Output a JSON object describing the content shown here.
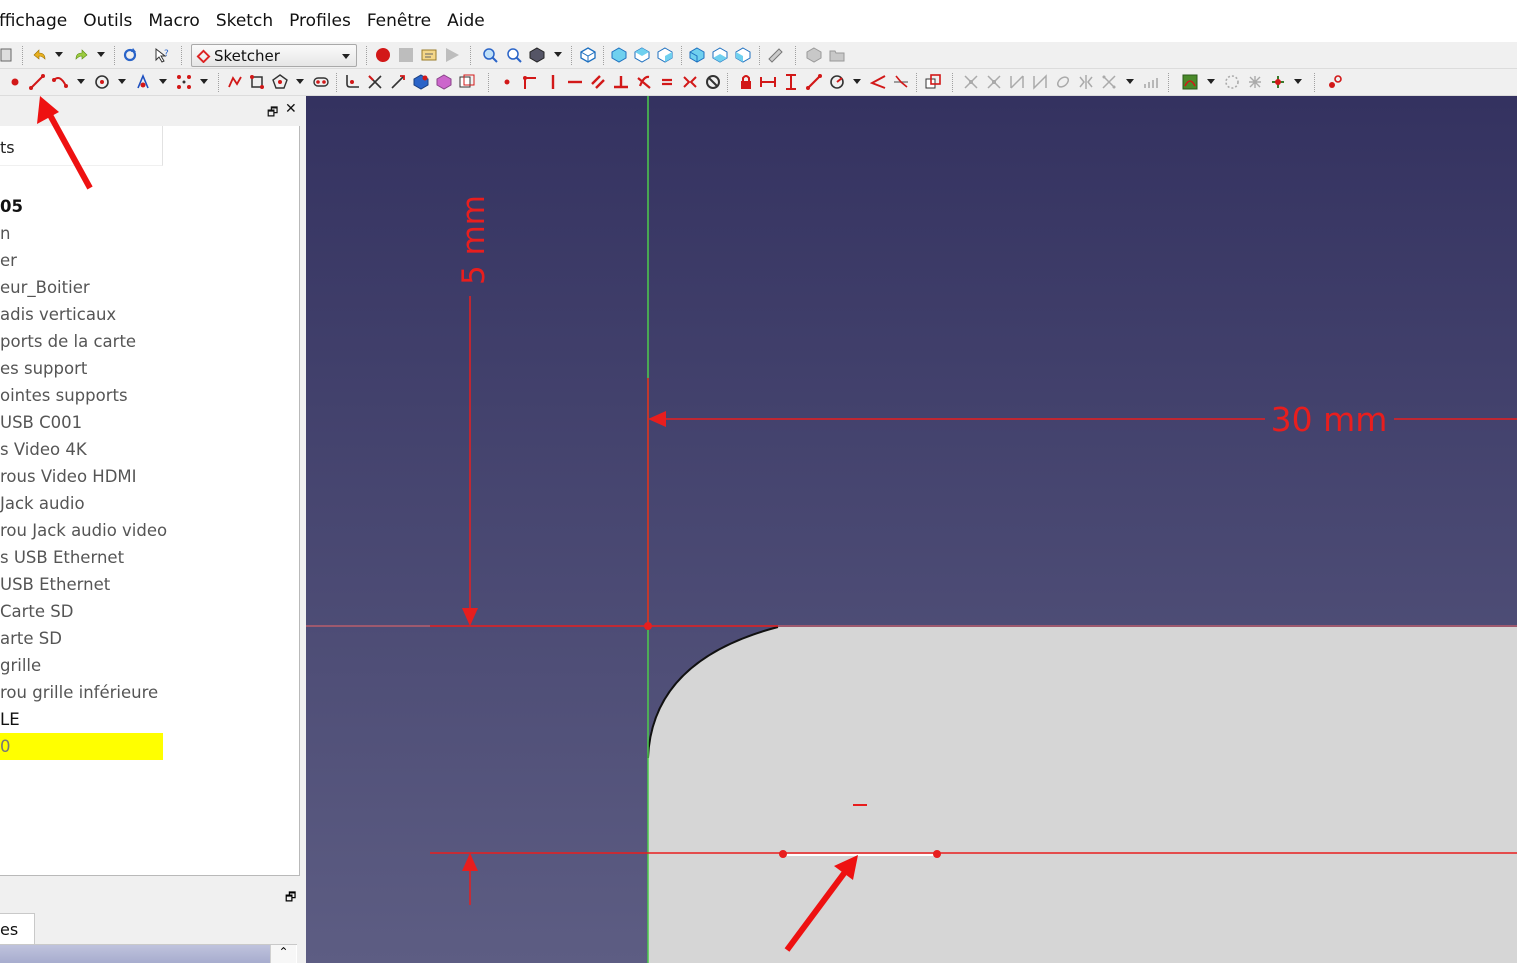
{
  "menubar": {
    "items": [
      "ffichage",
      "Outils",
      "Macro",
      "Sketch",
      "Profiles",
      "Fenêtre",
      "Aide"
    ]
  },
  "toolbar": {
    "workbench": "Sketcher"
  },
  "combo": {
    "tab_label": "ts"
  },
  "tree": {
    "items": [
      {
        "label": "05",
        "style": "bold"
      },
      {
        "label": "n",
        "style": "normal"
      },
      {
        "label": "er",
        "style": "normal"
      },
      {
        "label": "eur_Boitier",
        "style": "normal"
      },
      {
        "label": "adis verticaux",
        "style": "normal"
      },
      {
        "label": "ports de la carte",
        "style": "normal"
      },
      {
        "label": "es support",
        "style": "normal"
      },
      {
        "label": "ointes supports",
        "style": "normal"
      },
      {
        "label": "USB C001",
        "style": "normal"
      },
      {
        "label": "s Video 4K",
        "style": "normal"
      },
      {
        "label": "rous Video HDMI",
        "style": "normal"
      },
      {
        "label": "Jack audio",
        "style": "normal"
      },
      {
        "label": "rou Jack audio video",
        "style": "normal"
      },
      {
        "label": "s USB Ethernet",
        "style": "normal"
      },
      {
        "label": "USB Ethernet",
        "style": "normal"
      },
      {
        "label": "Carte SD",
        "style": "normal"
      },
      {
        "label": "arte SD",
        "style": "normal"
      },
      {
        "label": "grille",
        "style": "normal"
      },
      {
        "label": "rou grille inférieure",
        "style": "normal"
      },
      {
        "label": "LE",
        "style": "dark"
      },
      {
        "label": "0",
        "style": "highlight"
      }
    ]
  },
  "properties": {
    "tab_label": "es"
  },
  "sketch": {
    "dimension_horizontal": "30 mm",
    "dimension_vertical": "5 mm",
    "constraint_mark": "−",
    "colors": {
      "constraint": "#e81e1e",
      "axis_vertical": "#4dcc4d",
      "part_face": "#d6d6d6",
      "annotation_arrow": "#ee1111"
    }
  }
}
